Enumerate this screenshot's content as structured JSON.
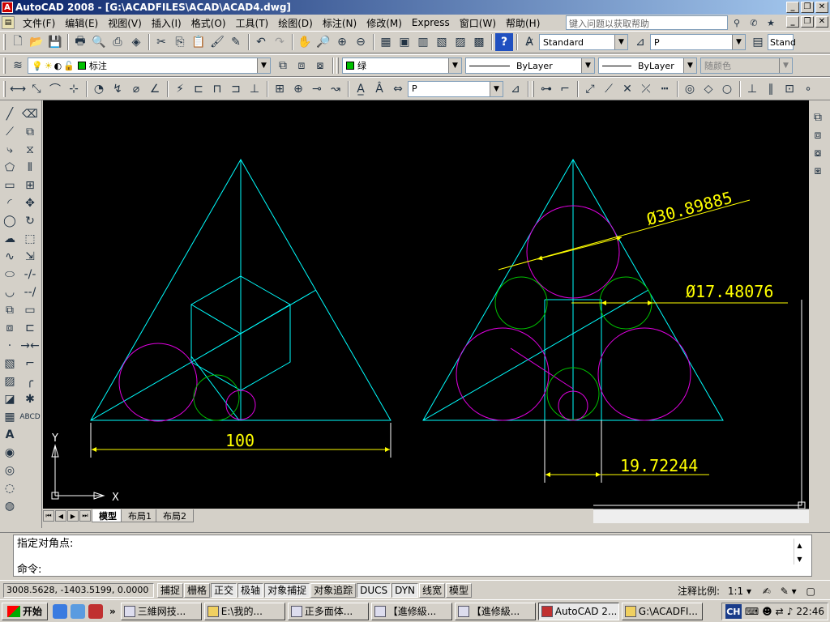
{
  "window": {
    "title": "AutoCAD 2008 - [G:\\ACADFILES\\ACAD\\ACAD4.dwg]",
    "icon": "A"
  },
  "menu": {
    "items": [
      "文件(F)",
      "编辑(E)",
      "视图(V)",
      "插入(I)",
      "格式(O)",
      "工具(T)",
      "绘图(D)",
      "标注(N)",
      "修改(M)",
      "Express",
      "窗口(W)",
      "帮助(H)"
    ],
    "help_placeholder": "键入问题以获取帮助"
  },
  "toolbar1": {
    "text_style": "Standard",
    "dim_style": "P",
    "table_style": "Stand"
  },
  "toolbar2": {
    "layer": "标注",
    "color": "绿",
    "color_hex": "#00c000",
    "linetype": "ByLayer",
    "lineweight": "ByLayer",
    "plotstyle": "随颜色"
  },
  "toolbar3": {
    "dim_style": "P"
  },
  "drawing": {
    "dim_left": "100",
    "dim_dia_large": "Ø30.89885",
    "dim_dia_small": "Ø17.48076",
    "dim_offset": "19.72244",
    "ucs_x": "X",
    "ucs_y": "Y",
    "colors": {
      "cyan": "#00ffff",
      "magenta": "#e000e0",
      "green": "#00c000",
      "yellow": "#ffff00",
      "white": "#ffffff"
    }
  },
  "tabs": [
    "模型",
    "布局1",
    "布局2"
  ],
  "command": {
    "line1": "指定对角点:",
    "line2": "命令:"
  },
  "status": {
    "coords": "3008.5628, -1403.5199, 0.0000",
    "buttons": [
      "捕捉",
      "栅格",
      "正交",
      "极轴",
      "对象捕捉",
      "对象追踪",
      "DUCS",
      "DYN",
      "线宽",
      "模型"
    ],
    "active": [
      "正交",
      "极轴",
      "对象捕捉",
      "DUCS",
      "DYN"
    ],
    "scale_label": "注释比例:",
    "scale_value": "1:1"
  },
  "taskbar": {
    "start": "开始",
    "tasks": [
      "三維网技...",
      "E:\\我的...",
      "正多面体...",
      "【進修級...",
      "【進修級...",
      "AutoCAD 2...",
      "G:\\ACADFI..."
    ],
    "active_task": "AutoCAD 2...",
    "ime": "CH",
    "clock": "22:46"
  }
}
